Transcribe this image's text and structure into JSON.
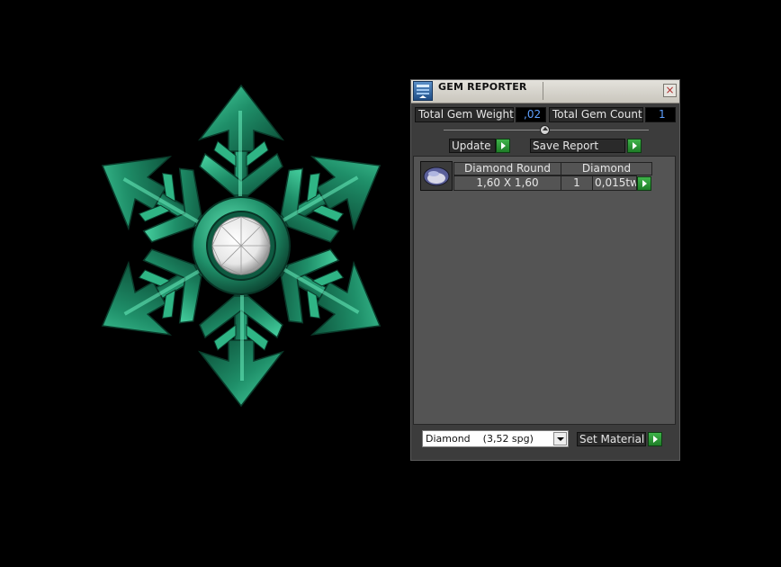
{
  "viewport": {
    "model_name": "snowflake-arrow-pendant",
    "metal_color": "#1f8f69",
    "stone_color": "#f2f2f2",
    "background": "#000000"
  },
  "panel": {
    "title": "GEM REPORTER",
    "title_icon": "gem-reporter-icon",
    "close_icon": "close-icon",
    "total_weight_label": "Total Gem Weight",
    "total_weight_value": ",02",
    "total_count_label": "Total Gem Count",
    "total_count_value": "1",
    "update_label": "Update",
    "save_report_label": "Save Report",
    "gems": [
      {
        "icon": "round-diamond-icon",
        "name": "Diamond Round",
        "material": "Diamond",
        "size": "1,60 X 1,60",
        "count": "1",
        "weight": "0,015tw"
      }
    ],
    "material_select_value": "Diamond    (3,52 spg)",
    "set_material_label": "Set Material",
    "accent_green": "#2ea03a",
    "value_blue": "#5ea0ff"
  }
}
